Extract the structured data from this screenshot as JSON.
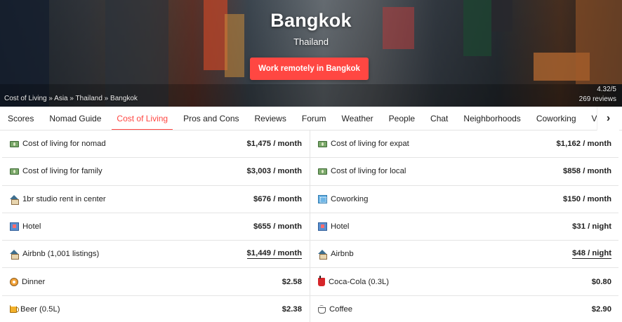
{
  "hero": {
    "city": "Bangkok",
    "country": "Thailand",
    "cta_label": "Work remotely in Bangkok",
    "breadcrumb": "Cost of Living » Asia » Thailand » Bangkok",
    "rating": "4.32/5",
    "reviews": "269 reviews"
  },
  "tabs": [
    {
      "label": "Scores",
      "active": false
    },
    {
      "label": "Nomad Guide",
      "active": false
    },
    {
      "label": "Cost of Living",
      "active": true
    },
    {
      "label": "Pros and Cons",
      "active": false
    },
    {
      "label": "Reviews",
      "active": false
    },
    {
      "label": "Forum",
      "active": false
    },
    {
      "label": "Weather",
      "active": false
    },
    {
      "label": "People",
      "active": false
    },
    {
      "label": "Chat",
      "active": false
    },
    {
      "label": "Neighborhoods",
      "active": false
    },
    {
      "label": "Coworking",
      "active": false
    },
    {
      "label": "Vi",
      "active": false
    }
  ],
  "tab_next_icon": "chevron-right-icon",
  "rows": [
    [
      {
        "icon": "money-icon",
        "label": "Cost of living for nomad",
        "value": "$1,475 / month",
        "link": false
      },
      {
        "icon": "money-icon",
        "label": "Cost of living for expat",
        "value": "$1,162 / month",
        "link": false
      }
    ],
    [
      {
        "icon": "money-icon",
        "label": "Cost of living for family",
        "value": "$3,003 / month",
        "link": false
      },
      {
        "icon": "money-icon",
        "label": "Cost of living for local",
        "value": "$858 / month",
        "link": false
      }
    ],
    [
      {
        "icon": "house-icon",
        "label": "1br studio rent in center",
        "value": "$676 / month",
        "link": false
      },
      {
        "icon": "coworking-icon",
        "label": "Coworking",
        "value": "$150 / month",
        "link": false
      }
    ],
    [
      {
        "icon": "hotel-icon",
        "label": "Hotel",
        "value": "$655 / month",
        "link": false
      },
      {
        "icon": "hotel-icon",
        "label": "Hotel",
        "value": "$31 / night",
        "link": false
      }
    ],
    [
      {
        "icon": "house-icon",
        "label": "Airbnb (1,001 listings)",
        "value": "$1,449 / month",
        "link": true
      },
      {
        "icon": "house-icon",
        "label": "Airbnb",
        "value": "$48 / night",
        "link": true
      }
    ],
    [
      {
        "icon": "dinner-icon",
        "label": "Dinner",
        "value": "$2.58",
        "link": false
      },
      {
        "icon": "cola-icon",
        "label": "Coca-Cola (0.3L)",
        "value": "$0.80",
        "link": false
      }
    ],
    [
      {
        "icon": "beer-icon",
        "label": "Beer (0.5L)",
        "value": "$2.38",
        "link": false
      },
      {
        "icon": "coffee-icon",
        "label": "Coffee",
        "value": "$2.90",
        "link": false
      }
    ]
  ],
  "colors": {
    "accent": "#ff4742",
    "border": "#e4e4e4",
    "text": "#222222"
  }
}
